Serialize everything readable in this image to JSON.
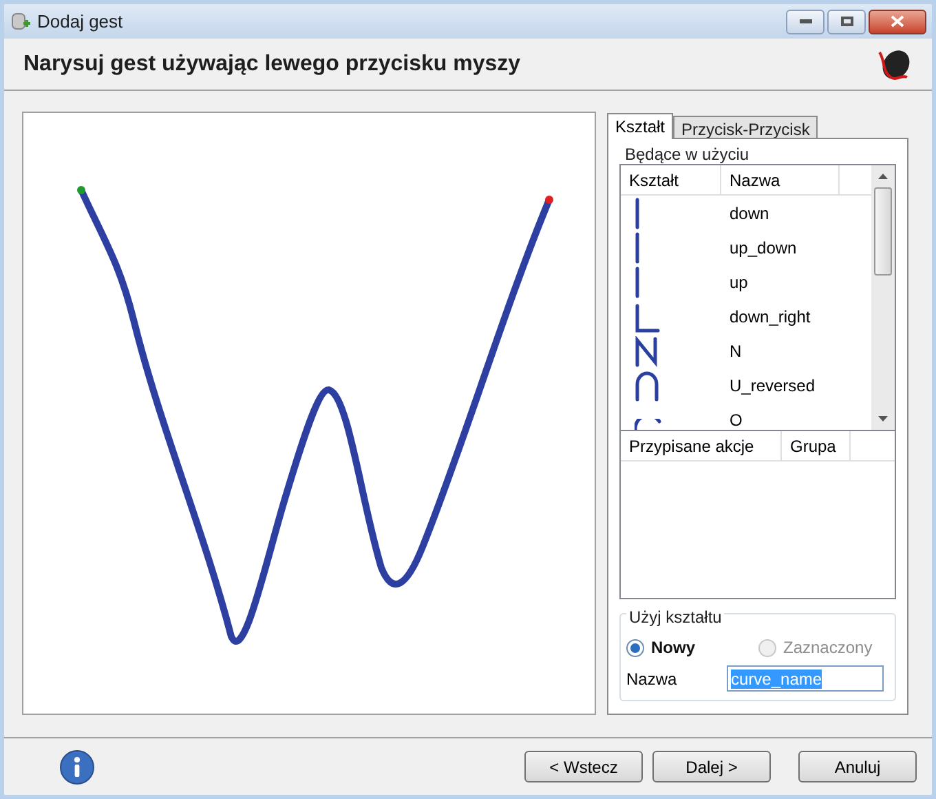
{
  "window": {
    "title": "Dodaj gest"
  },
  "header": {
    "title": "Narysuj gest używając lewego przycisku myszy"
  },
  "tabs": [
    {
      "label": "Kształt",
      "selected": true
    },
    {
      "label": "Przycisk-Przycisk",
      "selected": false
    }
  ],
  "gestures_group": {
    "title": "Będące w użyciu",
    "columns": [
      "Kształt",
      "Nazwa"
    ],
    "rows": [
      {
        "kind": "line",
        "name": "down"
      },
      {
        "kind": "line",
        "name": "up_down"
      },
      {
        "kind": "line",
        "name": "up"
      },
      {
        "kind": "corner",
        "name": "down_right"
      },
      {
        "kind": "zigzag",
        "name": "N"
      },
      {
        "kind": "arch",
        "name": "U_reversed"
      },
      {
        "kind": "circle",
        "name": "O"
      }
    ]
  },
  "actions_table": {
    "columns": [
      "Przypisane akcje",
      "Grupa"
    ]
  },
  "shape_group": {
    "title": "Użyj kształtu",
    "options": [
      {
        "label": "Nowy",
        "selected": true,
        "disabled": false
      },
      {
        "label": "Zaznaczony",
        "selected": false,
        "disabled": true
      }
    ],
    "name_label": "Nazwa",
    "name_value": "curve_name"
  },
  "buttons": [
    {
      "label": "< Wstecz"
    },
    {
      "label": "Dalej >"
    },
    {
      "label": "Anuluj"
    }
  ]
}
